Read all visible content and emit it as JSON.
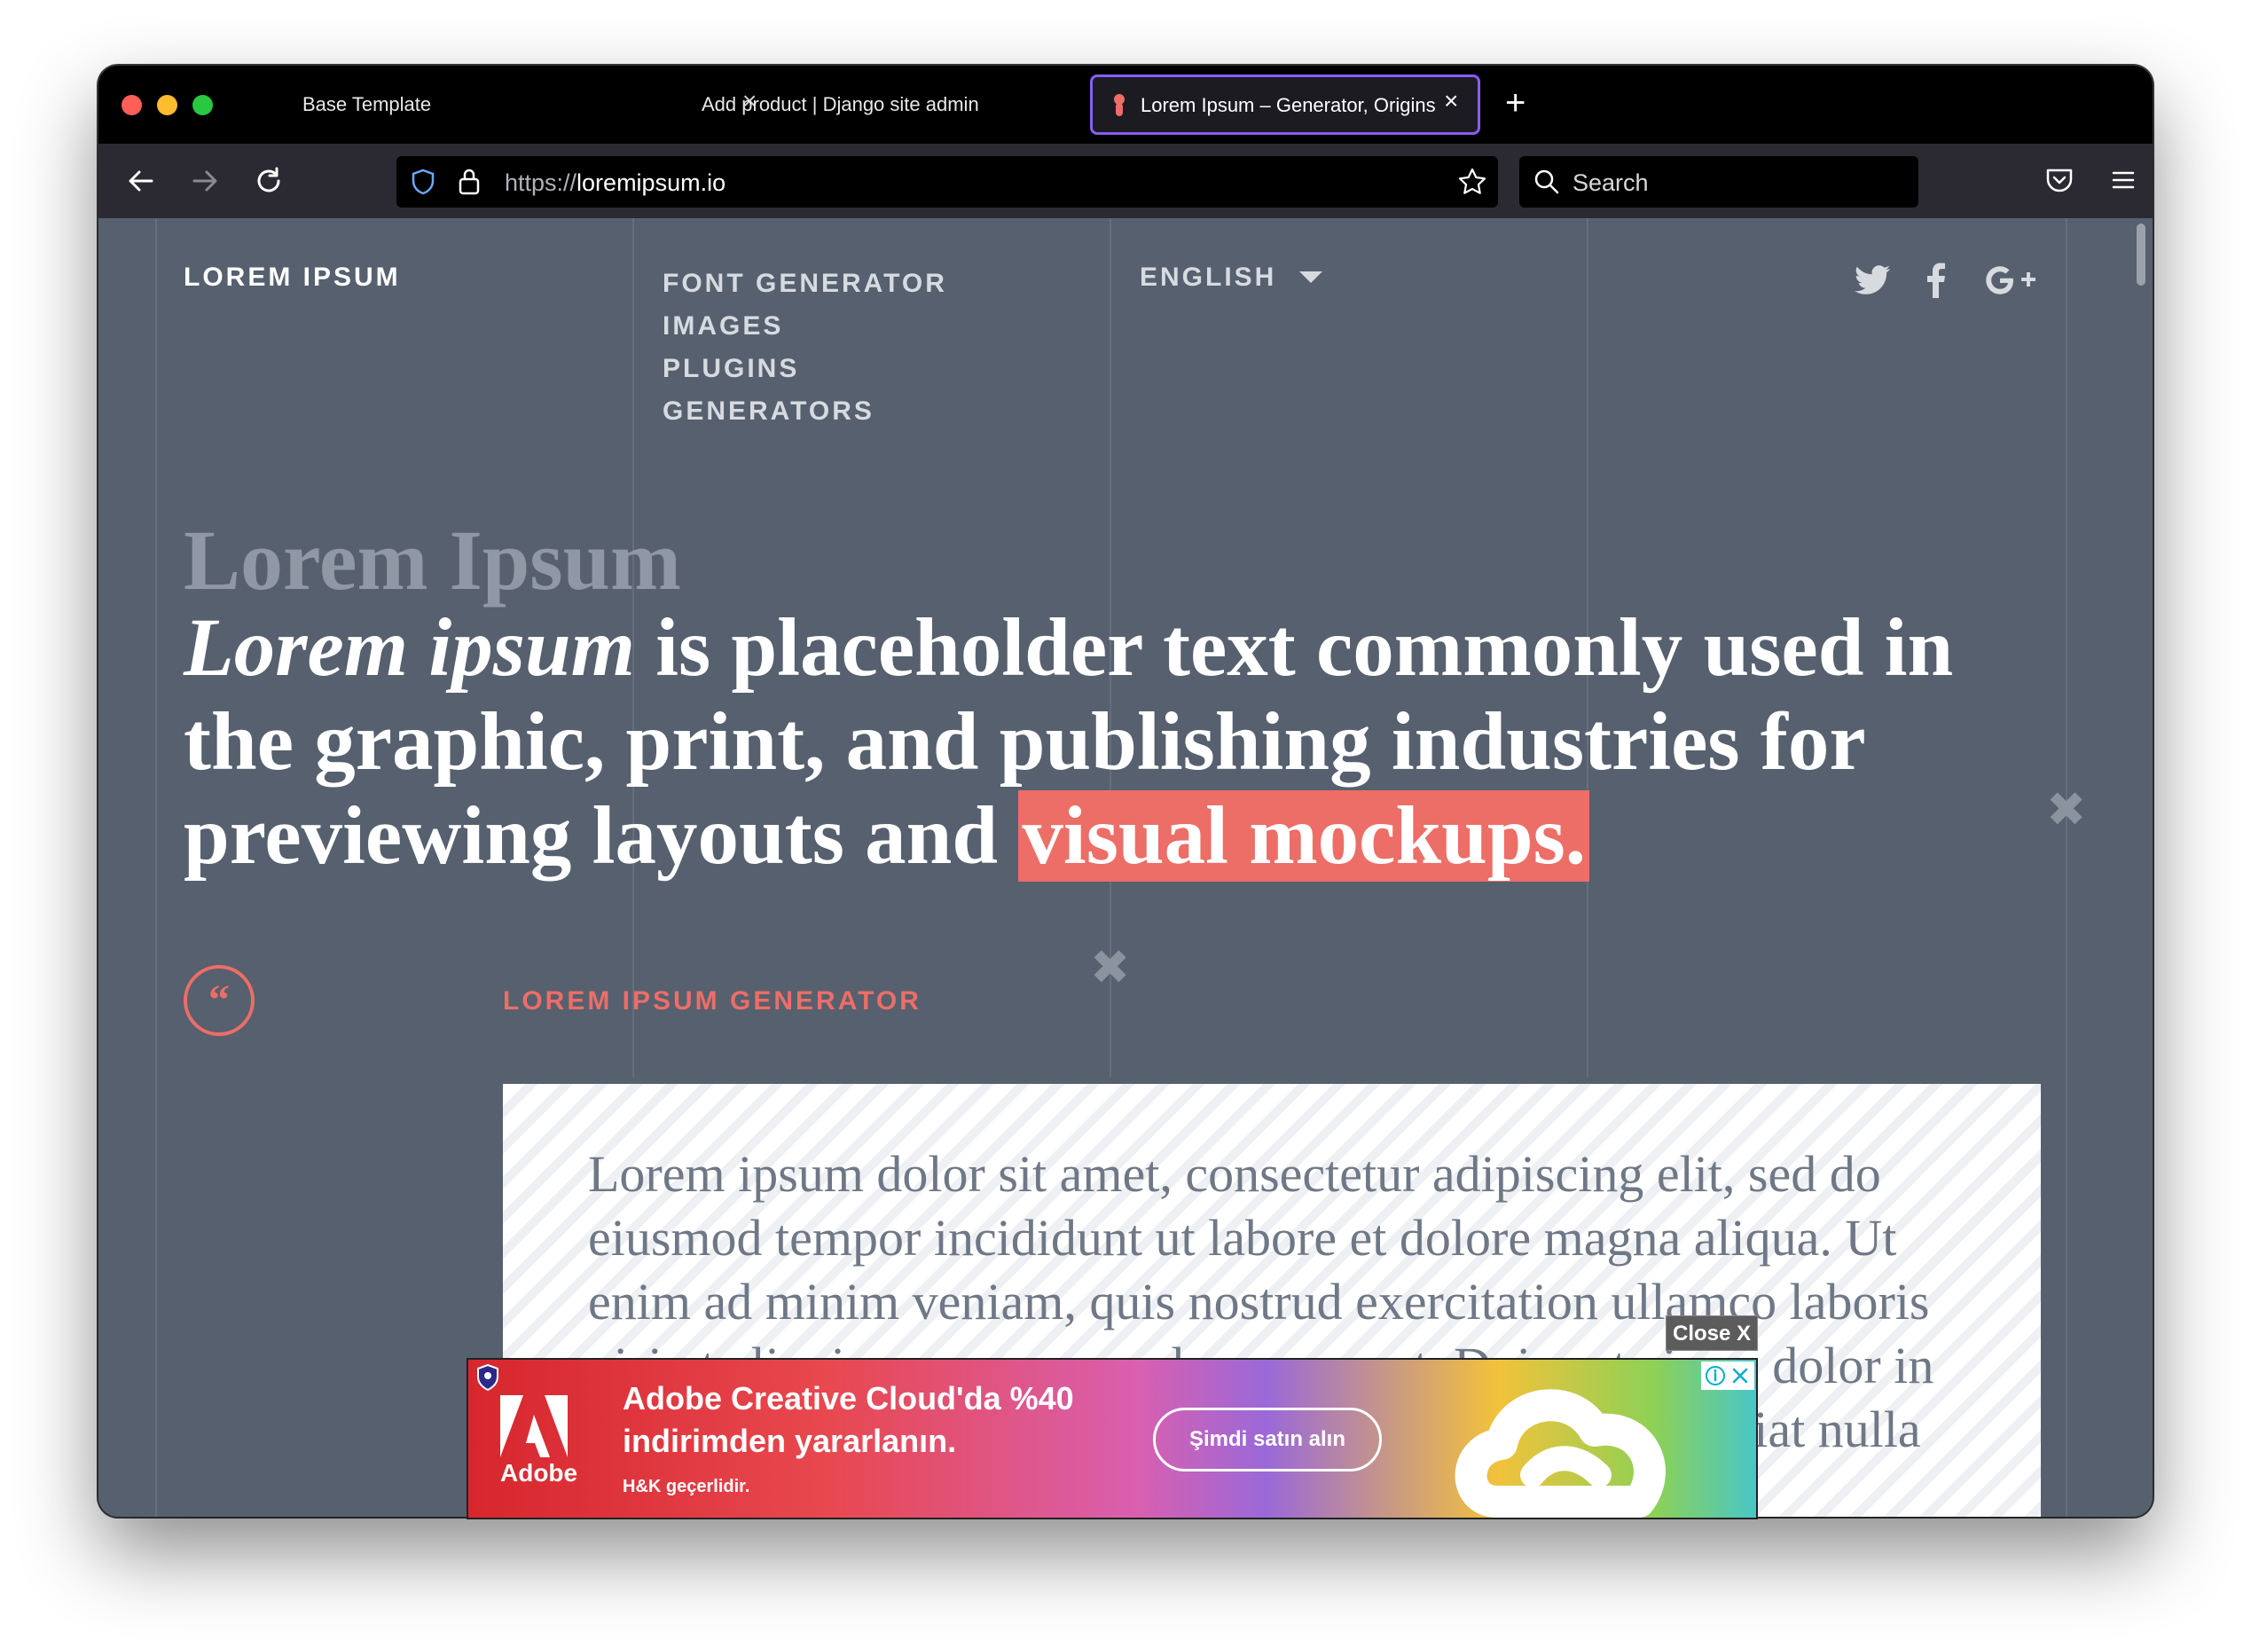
{
  "browser": {
    "tabs": [
      {
        "title": "Base Template",
        "active": false
      },
      {
        "title": "Add product | Django site admin",
        "active": false
      },
      {
        "title": "Lorem Ipsum – Generator, Origins and Meaning",
        "active": true
      }
    ],
    "url_scheme": "https://",
    "url_host": "loremipsum.io",
    "search_placeholder": "Search",
    "accent_color": "#8a5cf6"
  },
  "site": {
    "brand": "LOREM IPSUM",
    "nav": [
      "FONT GENERATOR",
      "IMAGES",
      "PLUGINS",
      "GENERATORS"
    ],
    "language": "ENGLISH",
    "social": [
      "twitter-icon",
      "facebook-icon",
      "google-plus-icon"
    ],
    "hero": {
      "title": "Lorem Ipsum",
      "lead_italic": "Lorem ipsum",
      "lead_text": " is placeholder text commonly used in the graphic, print, and publishing industries for previewing layouts and ",
      "lead_highlight": "visual mockups."
    },
    "quote_glyph": "“",
    "generator_label": "LOREM IPSUM GENERATOR",
    "generator_text": "Lorem ipsum dolor sit amet, consectetur adipiscing elit, sed do eiusmod tempor incididunt ut labore et dolore magna aliqua. Ut enim ad minim veniam, quis nostrud exercitation ullamco laboris nisi ut aliquip ex ea commodo consequat. Duis aute irure dolor in reprehenderit in voluptate velit esse cillum dolore eu fugiat nulla pariatur. Excepteur sint",
    "colors": {
      "background": "#56606e",
      "accent": "#ec6e67"
    }
  },
  "ad": {
    "close_label": "Close X",
    "brand": "Adobe",
    "headline_line1": "Adobe Creative Cloud'da %40",
    "headline_line2": "indirimden yararlanın.",
    "subtext": "H&K geçerlidir.",
    "cta": "Şimdi satın alın"
  }
}
